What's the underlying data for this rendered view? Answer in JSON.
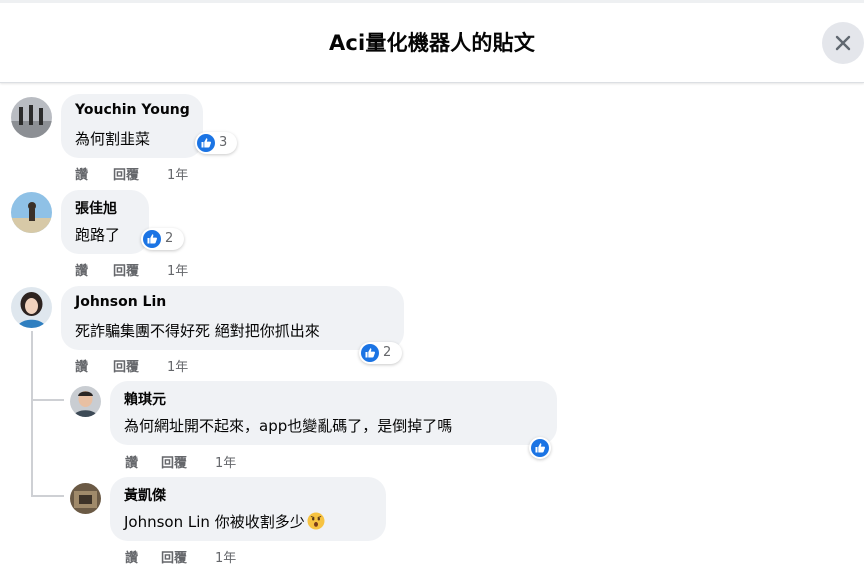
{
  "dialog": {
    "title": "Aci量化機器人的貼文"
  },
  "comments": [
    {
      "author": "Youchin Young",
      "text": "為何割韭菜",
      "likes": "3",
      "actions": {
        "like": "讚",
        "reply": "回覆",
        "time": "1年"
      }
    },
    {
      "author": "張佳旭",
      "text": "跑路了",
      "likes": "2",
      "actions": {
        "like": "讚",
        "reply": "回覆",
        "time": "1年"
      }
    },
    {
      "author": "Johnson Lin",
      "text": "死詐騙集團不得好死 絕對把你抓出來",
      "likes": "2",
      "actions": {
        "like": "讚",
        "reply": "回覆",
        "time": "1年"
      },
      "replies": [
        {
          "author": "賴琪元",
          "text": "為何網址開不起來，app也變亂碼了，是倒掉了嗎",
          "actions": {
            "like": "讚",
            "reply": "回覆",
            "time": "1年"
          }
        },
        {
          "author": "黃凱傑",
          "mention": "Johnson Lin",
          "text": " 你被收割多少",
          "actions": {
            "like": "讚",
            "reply": "回覆",
            "time": "1年"
          }
        }
      ]
    }
  ],
  "colors": {
    "like_blue": "#1b74e4",
    "bubble_bg": "#f0f2f5",
    "meta_gray": "#65676b"
  }
}
